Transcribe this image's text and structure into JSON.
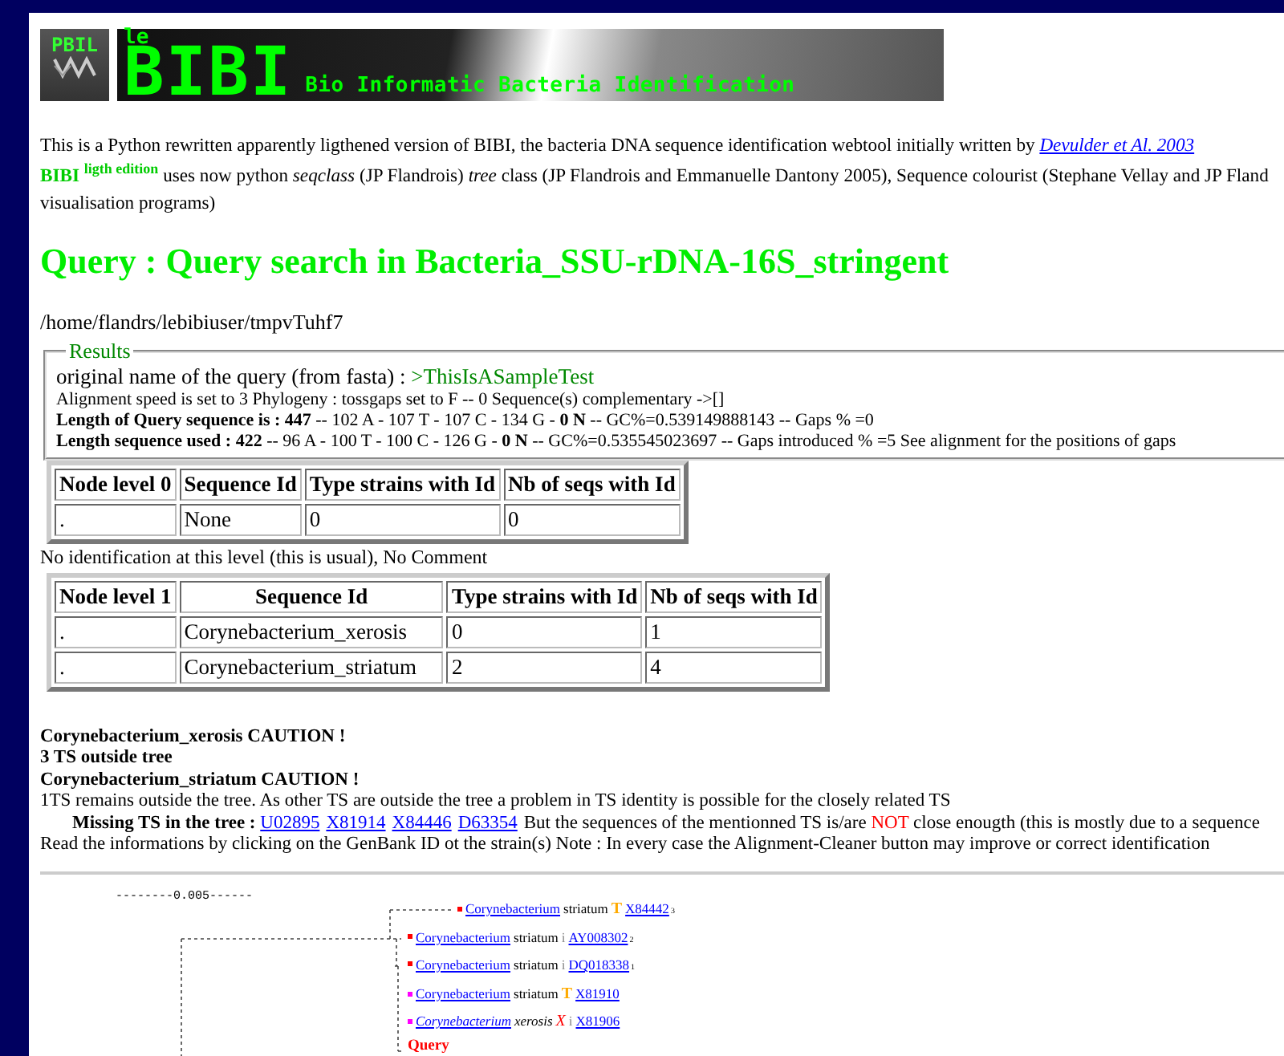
{
  "logo": {
    "badge": "PBIL",
    "prefix": "le",
    "title": "BIBI",
    "subtitle": "Bio Informatic Bacteria Identification"
  },
  "intro": {
    "line1": "This is a Python rewritten apparently ligthened version of BIBI, the bacteria DNA sequence identification webtool initially written by ",
    "line1_link": "Devulder et Al. 2003",
    "line2": "**BIBI** $^{ligth edition}$ uses now python *seqclass* (JP Flandrois) *tree* class (JP Flandrois and Emmanuelle Dantony 2005), Sequence colourist (Stephane Vellay and JP Fland",
    "line3": "visualisation programs)"
  },
  "heading": "Query : Query search in Bacteria_SSU-rDNA-16S_stringent",
  "path": "/home/flandrs/lebibiuser/tmpvTuhf7",
  "results": {
    "legend": "Results",
    "query_label": "original name of the query (from fasta) : ",
    "query_name": ">ThisIsASampleTest",
    "lines": [
      "Alignment speed is set to 3 Phylogeny : tossgaps set to F -- 0 Sequence(s) complementary ->[]",
      "**Length of Query sequence is : 447** -- 102 A - 107 T - 107 C - 134 G - **0 N** -- GC%=0.539149888143 -- Gaps % =0",
      "**Length sequence used : 422** -- 96 A - 100 T - 100 C - 126 G - **0 N** -- GC%=0.535545023697 -- Gaps introduced % =5 See alignment for the positions of gaps"
    ]
  },
  "tables": [
    {
      "columns": [
        "Node level 0",
        "Sequence Id",
        "Type strains with Id",
        "Nb of seqs with Id"
      ],
      "rows": [
        [
          ".",
          "None",
          "0",
          "0"
        ]
      ],
      "comment": "No identification at this level (this is usual), No Comment"
    },
    {
      "columns": [
        "Node level 1",
        "Sequence Id",
        "Type strains with Id",
        "Nb of seqs with Id"
      ],
      "rows": [
        [
          ".",
          "Corynebacterium_xerosis",
          "0",
          "1"
        ],
        [
          ".",
          "Corynebacterium_striatum",
          "2",
          "4"
        ]
      ]
    }
  ],
  "cautions": [
    "Corynebacterium_xerosis CAUTION !",
    "3 TS outside tree",
    "Corynebacterium_striatum CAUTION !"
  ],
  "remark": "1TS remains outside the tree. As other TS are outside the tree a problem in TS identity is possible for the closely related TS",
  "missing": {
    "label": "Missing TS in the tree :",
    "links": [
      "U02895",
      "X81914",
      "X84446",
      "D63354"
    ],
    "text_before": " But the sequences of the mentionned TS is/are ",
    "emphasis": "NOT",
    "text_after": " close enougth (this is mostly due to a sequence"
  },
  "note": "Read the informations by clicking on the GenBank ID ot the strain(s) Note : In every case the Alignment-Cleaner button may improve or correct identification",
  "tree": {
    "scale": "--------0.005------",
    "query": "Query",
    "leaves": [
      {
        "color": "#ff0000",
        "genus": "Corynebacterium",
        "species": "striatum",
        "italic": false,
        "kind": "type",
        "mark": "T",
        "accession": "X84442",
        "count": "3"
      },
      {
        "color": "#ff0000",
        "genus": "Corynebacterium",
        "species": "striatum",
        "italic": false,
        "kind": "isolate",
        "mark": "i",
        "accession": "AY008302",
        "count": "2"
      },
      {
        "color": "#ff0000",
        "genus": "Corynebacterium",
        "species": "striatum",
        "italic": false,
        "kind": "isolate",
        "mark": "i",
        "accession": "DQ018338",
        "count": "1"
      },
      {
        "color": "#ff00ff",
        "genus": "Corynebacterium",
        "species": "striatum",
        "italic": false,
        "kind": "type",
        "mark": "T",
        "accession": "X81910"
      },
      {
        "color": "#ff00ff",
        "genus": "Corynebacterium",
        "species": "xerosis",
        "italic": true,
        "kind": "excluded",
        "mark": "X",
        "mark2": "i",
        "accession": "X81906"
      }
    ]
  }
}
